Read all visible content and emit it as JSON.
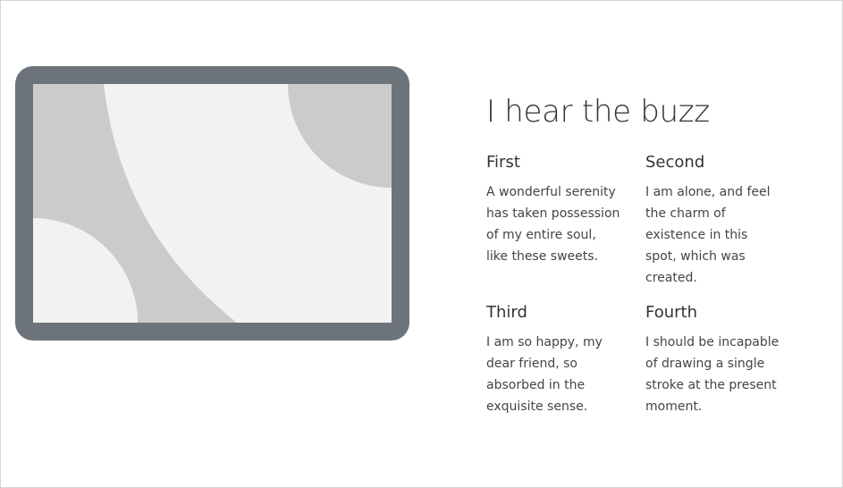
{
  "hero": {
    "title": "I hear the buzz"
  },
  "features": [
    {
      "title": "First",
      "text": "A wonderful serenity has taken possession of my entire soul, like these sweets."
    },
    {
      "title": "Second",
      "text": "I am alone, and feel the charm of existence in this spot, which was created."
    },
    {
      "title": "Third",
      "text": "I am so happy, my dear friend, so absorbed in the exquisite sense."
    },
    {
      "title": "Fourth",
      "text": "I should be incapable of drawing a single stroke at the present moment."
    }
  ],
  "colors": {
    "device_frame": "#6c737b",
    "screen_background": "#f2f2f2",
    "shape_fill": "#cbcbcb",
    "text": "#333333"
  }
}
